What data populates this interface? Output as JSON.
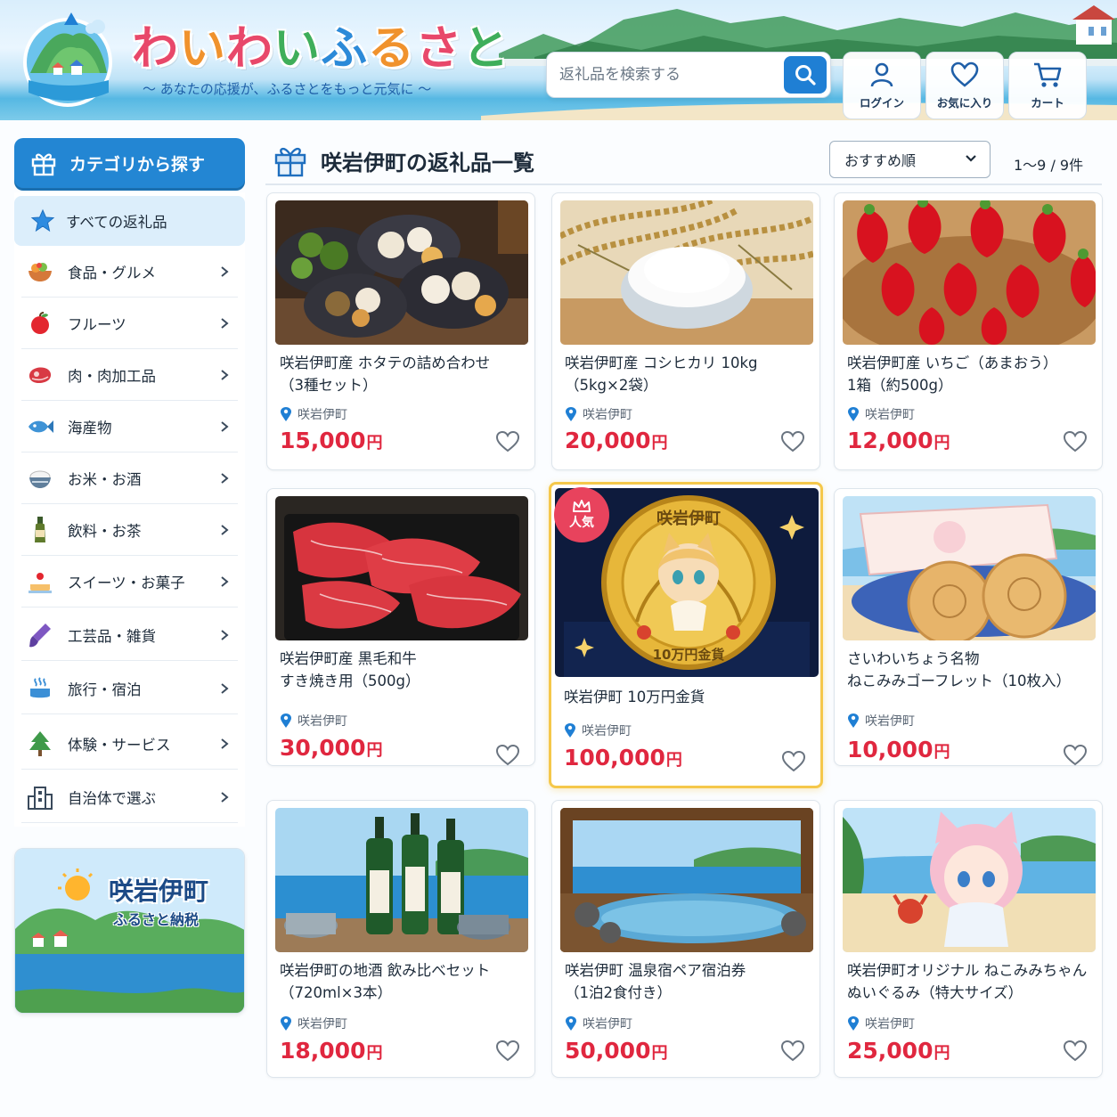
{
  "header": {
    "brand_title": "わいわいふるさと",
    "tagline": "〜 あなたの応援が、ふるさとをもっと元気に 〜",
    "search_placeholder": "返礼品を検索する",
    "login_label": "ログイン",
    "favorites_label": "お気に入り",
    "cart_label": "カート"
  },
  "sidebar": {
    "heading": "カテゴリから探す",
    "all_label": "すべての返礼品",
    "items": [
      {
        "label": "食品・グルメ",
        "icon": "food-bowl-icon"
      },
      {
        "label": "フルーツ",
        "icon": "apple-icon"
      },
      {
        "label": "肉・肉加工品",
        "icon": "meat-icon"
      },
      {
        "label": "海産物",
        "icon": "fish-icon"
      },
      {
        "label": "お米・お酒",
        "icon": "rice-bowl-icon"
      },
      {
        "label": "飲料・お茶",
        "icon": "bottle-icon"
      },
      {
        "label": "スイーツ・お菓子",
        "icon": "cake-icon"
      },
      {
        "label": "工芸品・雑貨",
        "icon": "brush-icon"
      },
      {
        "label": "旅行・宿泊",
        "icon": "hot-spring-icon"
      },
      {
        "label": "体験・サービス",
        "icon": "tree-icon"
      },
      {
        "label": "自治体で選ぶ",
        "icon": "building-icon"
      }
    ],
    "promo_title": "咲岩伊町",
    "promo_subtitle": "ふるさと納税"
  },
  "main": {
    "title": "咲岩伊町の返礼品一覧",
    "sort_selected": "おすすめ順",
    "result_count": "1〜9 / 9件",
    "yen": "円",
    "popular_badge": "人気",
    "coin_text_top": "咲岩伊町",
    "coin_text_bottom": "10万円金貨",
    "products": [
      {
        "title_line1": "咲岩伊町産 ホタテの詰め合わせ",
        "title_line2": "（3種セット）",
        "location": "咲岩伊町",
        "price": "15,000"
      },
      {
        "title_line1": "咲岩伊町産 コシヒカリ 10kg",
        "title_line2": "（5kg×2袋）",
        "location": "咲岩伊町",
        "price": "20,000"
      },
      {
        "title_line1": "咲岩伊町産 いちご（あまおう）",
        "title_line2": "1箱（約500g）",
        "location": "咲岩伊町",
        "price": "12,000"
      },
      {
        "title_line1": "咲岩伊町産 黒毛和牛",
        "title_line2": "すき焼き用（500g）",
        "location": "咲岩伊町",
        "price": "30,000"
      },
      {
        "title_line1": "咲岩伊町 10万円金貨",
        "title_line2": "",
        "location": "咲岩伊町",
        "price": "100,000",
        "featured": true
      },
      {
        "title_line1": "さいわいちょう名物",
        "title_line2": "ねこみみゴーフレット（10枚入）",
        "location": "咲岩伊町",
        "price": "10,000"
      },
      {
        "title_line1": "咲岩伊町の地酒 飲み比べセット",
        "title_line2": "（720ml×3本）",
        "location": "咲岩伊町",
        "price": "18,000"
      },
      {
        "title_line1": "咲岩伊町 温泉宿ペア宿泊券",
        "title_line2": "（1泊2食付き）",
        "location": "咲岩伊町",
        "price": "50,000"
      },
      {
        "title_line1": "咲岩伊町オリジナル ねこみみちゃん",
        "title_line2": "ぬいぐるみ（特大サイズ）",
        "location": "咲岩伊町",
        "price": "25,000"
      }
    ]
  },
  "colors": {
    "accent": "#2386d3",
    "price": "#e0273f",
    "featured_border": "#f5c84b",
    "badge": "#e8435d"
  }
}
